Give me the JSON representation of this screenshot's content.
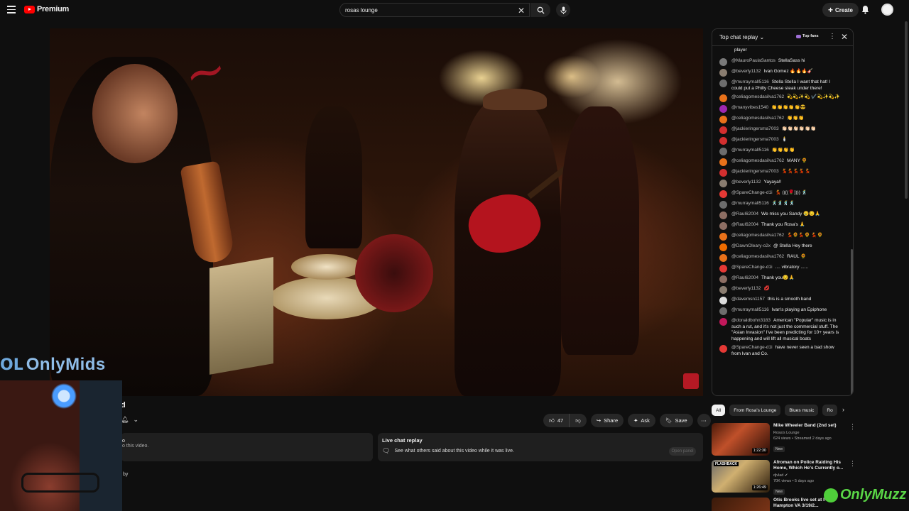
{
  "app": {
    "brand": "Premium"
  },
  "search": {
    "value": "rosas lounge"
  },
  "header": {
    "create_label": "Create"
  },
  "video": {
    "title_fragment": "d",
    "likes": "47",
    "share_label": "Share",
    "ask_label": "Ask",
    "save_label": "Save"
  },
  "description": {
    "line1": "o",
    "line2": "o this video."
  },
  "live_chat_box": {
    "title": "Live chat replay",
    "text": "See what others said about this video while it was live.",
    "open_label": "Open panel"
  },
  "below_text": "by",
  "overlay": {
    "left_brand": "OnlyMids",
    "right_brand": "OnlyMuzz"
  },
  "chat": {
    "title": "Top chat replay",
    "top_fans": "Top fans",
    "messages": [
      {
        "author": "",
        "text": "player",
        "color": "#8a8a8a"
      },
      {
        "author": "@MauroPaulaSantos",
        "text": "StellaSass hi",
        "color": "#7a7a7a"
      },
      {
        "author": "@beverly1132",
        "text": "Ivan Gomez 🔥🔥🔥🎸",
        "color": "#8a7d70"
      },
      {
        "author": "@murraymall5116",
        "text": "Stella Stella I want that hat! I could put a Philly Cheese steak under there!",
        "color": "#6d6d6d"
      },
      {
        "author": "@celiagomesdasilva1762",
        "text": "💫💫✨💫 ✔️💫✨💫✨",
        "color": "#e8711a"
      },
      {
        "author": "@manyvibes1540",
        "text": "👏👏👏👏👏😎",
        "color": "#9c27b0"
      },
      {
        "author": "@celiagomesdasilva1762",
        "text": "👏👏👏",
        "color": "#e8711a"
      },
      {
        "author": "@jackieringersma7003",
        "text": "👏🏻👏🏻👏🏻👏🏻👏🏻👏🏻",
        "color": "#d32f2f"
      },
      {
        "author": "@jackieringersma7003",
        "text": "🕯️",
        "color": "#d32f2f"
      },
      {
        "author": "@murraymall5116",
        "text": "👏👏👏👏",
        "color": "#6d6d6d"
      },
      {
        "author": "@celiagomesdasilva1762",
        "text": "MANY 🌻",
        "color": "#e8711a"
      },
      {
        "author": "@jackieringersma7003",
        "text": "💃💃💃💃💃",
        "color": "#d32f2f"
      },
      {
        "author": "@beverly1132",
        "text": "Yayaya!!",
        "color": "#8a7d70"
      },
      {
        "author": "@SpareChange-d1i",
        "text": "💃 ((((🌹)))) 🕺",
        "color": "#e53935"
      },
      {
        "author": "@murraymall5116",
        "text": "🕺🕺🕺🕺",
        "color": "#6d6d6d"
      },
      {
        "author": "@Raul62004",
        "text": "We miss you Sandy 😢😔🙏",
        "color": "#8d6e63"
      },
      {
        "author": "@Raul62004",
        "text": "Thank you Rosa's 🙏",
        "color": "#8d6e63"
      },
      {
        "author": "@celiagomesdasilva1762",
        "text": "💃🌻💃🌻 💃🌻",
        "color": "#e8711a"
      },
      {
        "author": "@DawnOleary-o2x",
        "text": "@ Stella Hey there",
        "color": "#ef6c00"
      },
      {
        "author": "@celiagomesdasilva1762",
        "text": "RAUL 🌻",
        "color": "#e8711a"
      },
      {
        "author": "@SpareChange-d1i",
        "text": ".... vibratory ......",
        "color": "#e53935"
      },
      {
        "author": "@Raul62004",
        "text": "Thank you😔🙏",
        "color": "#8d6e63"
      },
      {
        "author": "@beverly1132",
        "text": "💋",
        "color": "#8a7d70"
      },
      {
        "author": "@davemsn1157",
        "text": "this is a smooth band",
        "color": "#dddddd"
      },
      {
        "author": "@murraymall5116",
        "text": "Ivan's playing an Epiphone",
        "color": "#6d6d6d"
      },
      {
        "author": "@donaldbohn3183",
        "text": "American \"Popular\" music is in such a rut, and it's not just the commercial stuff. The \"Asian Invasion\" I've been predicting for 10+ years is happening and will lift all musical boats",
        "color": "#c2185b"
      },
      {
        "author": "@SpareChange-d1i",
        "text": "have never seen a bad show from Ivan and Co.",
        "color": "#e53935"
      }
    ]
  },
  "chips": [
    "All",
    "From Rosa's Lounge",
    "Blues music",
    "Ro"
  ],
  "recommendations": [
    {
      "title": "Mike Wheeler Band (2nd set)",
      "channel": "Rosa's Lounge",
      "stats": "624 views • Streamed 2 days ago",
      "badge": "New",
      "duration": "1:22:30"
    },
    {
      "title": "Afroman on Police Raiding His Home, Which He's Currently o...",
      "channel": "djvlad",
      "stats": "70K views • 5 days ago",
      "badge": "New",
      "duration": "1:26:49",
      "thumb_label": "FLASHBACK"
    },
    {
      "title": "Otis Brooks live set at Pink Hampton VA 3/19/2...",
      "channel": "",
      "stats": "",
      "badge": "",
      "duration": ""
    }
  ]
}
